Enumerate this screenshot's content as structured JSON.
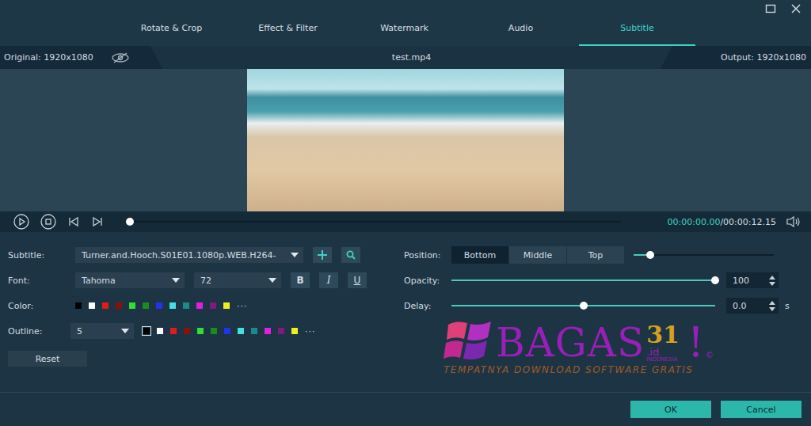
{
  "tabs": [
    {
      "label": "Rotate & Crop",
      "selected": false
    },
    {
      "label": "Effect & Filter",
      "selected": false
    },
    {
      "label": "Watermark",
      "selected": false
    },
    {
      "label": "Audio",
      "selected": false
    },
    {
      "label": "Subtitle",
      "selected": true
    }
  ],
  "info": {
    "original": "Original: 1920x1080",
    "file": "test.mp4",
    "output": "Output: 1920x1080"
  },
  "player": {
    "current": "00:00:00.00",
    "total": "/00:00:12.15",
    "level": 0
  },
  "subtitle": {
    "label": "Subtitle:",
    "value": "Turner.and.Hooch.S01E01.1080p.WEB.H264-"
  },
  "font": {
    "label": "Font:",
    "family": "Tahoma",
    "size": "72",
    "styles": [
      {
        "label": "B",
        "on": false
      },
      {
        "label": "I",
        "on": false
      },
      {
        "label": "U",
        "on": false
      }
    ]
  },
  "color": {
    "label": "Color:",
    "swatches": [
      {
        "color": "#000000",
        "selected": false
      },
      {
        "color": "#ffffff",
        "selected": false
      },
      {
        "color": "#e01b1b",
        "selected": false
      },
      {
        "color": "#8a1010",
        "selected": false
      },
      {
        "color": "#33dd33",
        "selected": false
      },
      {
        "color": "#1d8a1d",
        "selected": false
      },
      {
        "color": "#2233ee",
        "selected": false
      },
      {
        "color": "#44e0e0",
        "selected": false
      },
      {
        "color": "#1a8a8a",
        "selected": false
      },
      {
        "color": "#e020e0",
        "selected": false
      },
      {
        "color": "#801a80",
        "selected": false
      },
      {
        "color": "#eeee22",
        "selected": false
      }
    ],
    "more": "···"
  },
  "outline": {
    "label": "Outline:",
    "value": "5",
    "swatches": [
      {
        "color": "#000000",
        "selected": true
      },
      {
        "color": "#ffffff",
        "selected": false
      },
      {
        "color": "#e01b1b",
        "selected": false
      },
      {
        "color": "#8a1010",
        "selected": false
      },
      {
        "color": "#33dd33",
        "selected": false
      },
      {
        "color": "#1d8a1d",
        "selected": false
      },
      {
        "color": "#2233ee",
        "selected": false
      },
      {
        "color": "#44e0e0",
        "selected": false
      },
      {
        "color": "#1a8a8a",
        "selected": false
      },
      {
        "color": "#e020e0",
        "selected": false
      },
      {
        "color": "#801a80",
        "selected": false
      },
      {
        "color": "#eeee22",
        "selected": false
      }
    ],
    "more": "···"
  },
  "reset": "Reset",
  "position": {
    "label": "Position:",
    "options": [
      {
        "label": "Bottom",
        "selected": true
      },
      {
        "label": "Middle",
        "selected": false
      },
      {
        "label": "Top",
        "selected": false
      }
    ],
    "level": 0.12
  },
  "opacity": {
    "label": "Opacity:",
    "level": 1,
    "value": "100"
  },
  "delay": {
    "label": "Delay:",
    "level": 0.5,
    "value": "0.0",
    "unit": "s"
  },
  "buttons": [
    "OK",
    "Cancel"
  ],
  "watermark": {
    "name": "BAGAS",
    "number": "31",
    "domain": ".id",
    "country": "INDONESIA",
    "exclaim": "!",
    "mark": "©",
    "tagline": "TEMPATNYA DOWNLOAD SOFTWARE GRATIS"
  }
}
